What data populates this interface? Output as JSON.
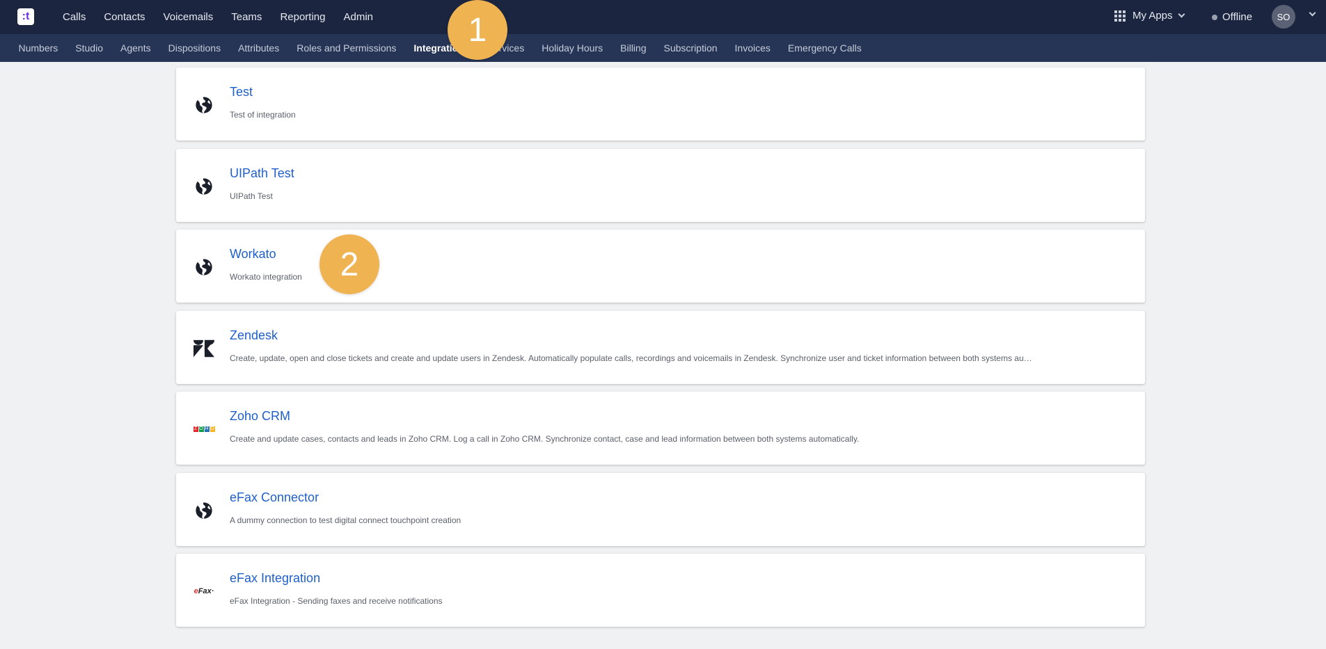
{
  "topbar": {
    "logo_text": ":t",
    "nav": [
      "Calls",
      "Contacts",
      "Voicemails",
      "Teams",
      "Reporting",
      "Admin"
    ],
    "my_apps": "My Apps",
    "status": "Offline",
    "avatar": "SO"
  },
  "subnav": {
    "items": [
      "Numbers",
      "Studio",
      "Agents",
      "Dispositions",
      "Attributes",
      "Roles and Permissions",
      "Integrations",
      "Services",
      "Holiday Hours",
      "Billing",
      "Subscription",
      "Invoices",
      "Emergency Calls"
    ],
    "active": "Integrations"
  },
  "integrations": [
    {
      "icon": "globe-icon",
      "title": "Test",
      "description": "Test of integration"
    },
    {
      "icon": "globe-icon",
      "title": "UIPath Test",
      "description": "UIPath Test"
    },
    {
      "icon": "globe-icon",
      "title": "Workato",
      "description": "Workato integration"
    },
    {
      "icon": "zendesk-logo",
      "title": "Zendesk",
      "description": "Create, update, open and close tickets and create and update users in Zendesk. Automatically populate calls, recordings and voicemails in Zendesk. Synchronize user and ticket information between both systems au…"
    },
    {
      "icon": "zoho-logo",
      "title": "Zoho CRM",
      "description": "Create and update cases, contacts and leads in Zoho CRM. Log a call in Zoho CRM. Synchronize contact, case and lead information between both systems automatically."
    },
    {
      "icon": "globe-icon",
      "title": "eFax Connector",
      "description": "A dummy connection to test digital connect touchpoint creation"
    },
    {
      "icon": "efax-logo",
      "title": "eFax Integration",
      "description": "eFax Integration - Sending faxes and receive notifications"
    }
  ],
  "zoho_logo": {
    "letters": [
      "Z",
      "O",
      "H",
      "O"
    ]
  },
  "efax_logo": {
    "e": "e",
    "rest": "Fax",
    "mark": "·"
  },
  "badges": [
    "1",
    "2"
  ],
  "colors": {
    "topbar": "#1b2540",
    "subbar": "#263456",
    "link": "#1f5fc9",
    "badge": "#efb351"
  }
}
